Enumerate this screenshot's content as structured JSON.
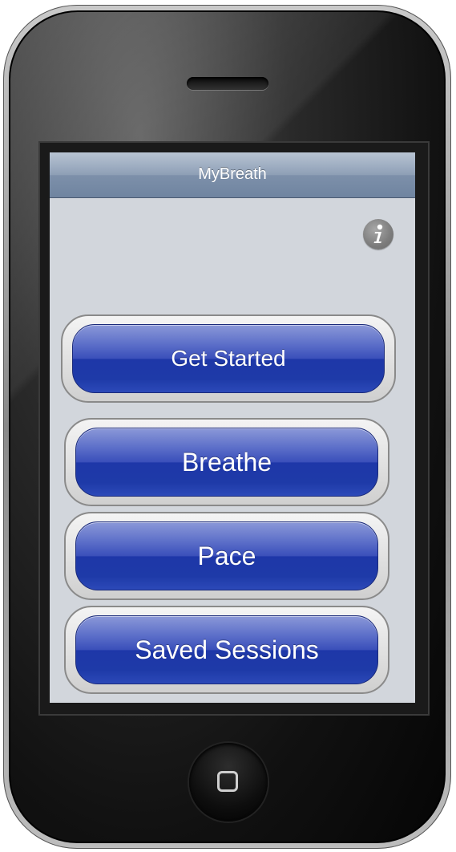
{
  "app": {
    "title": "MyBreath"
  },
  "icons": {
    "info": "info-icon",
    "home": "home-button-icon"
  },
  "menu": {
    "items": [
      {
        "label": "Get Started"
      },
      {
        "label": "Breathe"
      },
      {
        "label": "Pace"
      },
      {
        "label": "Saved Sessions"
      }
    ]
  },
  "colors": {
    "navbar": "#8e9fb6",
    "background": "#d2d6dc",
    "button_blue": "#1e37a8",
    "text": "#ffffff"
  }
}
